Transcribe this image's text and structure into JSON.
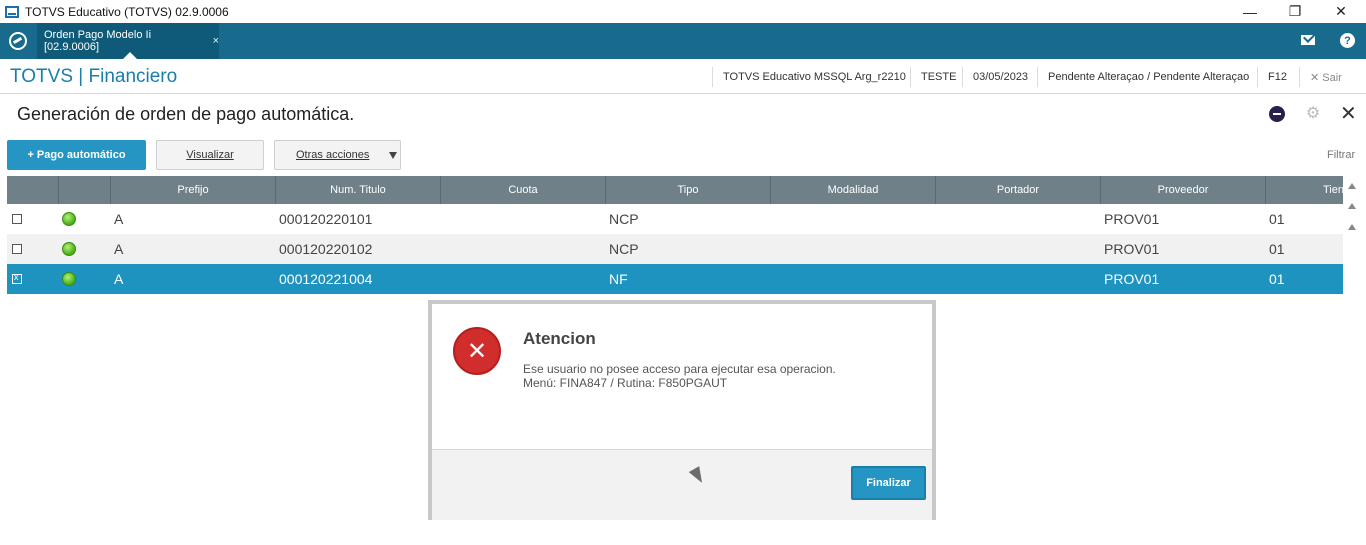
{
  "window": {
    "title": "TOTVS Educativo (TOTVS) 02.9.0006",
    "minimize": "—",
    "restore": "❐",
    "close": "✕"
  },
  "tabs": [
    {
      "label": "Orden Pago Modelo Ii [02.9.0006]",
      "close": "×"
    }
  ],
  "header": {
    "brand": "TOTVS | Financiero",
    "environment": "TOTVS Educativo MSSQL Arg_r2210",
    "user": "TESTE",
    "date": "03/05/2023",
    "status": "Pendente Alteraçao / Pendente Alteraçao",
    "shortcut": "F12",
    "exit": "✕  Sair",
    "help": "?"
  },
  "page": {
    "title": "Generación de orden de pago automática."
  },
  "toolbar": {
    "primary_label": "+ Pago automático",
    "visualizar_label": "Visualizar",
    "otras_label": "Otras acciones",
    "filter_label": "Filtrar"
  },
  "grid": {
    "columns": [
      "",
      "",
      "Prefijo",
      "Num. Titulo",
      "Cuota",
      "Tipo",
      "Modalidad",
      "Portador",
      "Proveedor",
      "Tien"
    ],
    "rows": [
      {
        "checked": false,
        "prefijo": "A",
        "num_titulo": "000120220101",
        "cuota": "",
        "tipo": "NCP",
        "modalidad": "",
        "portador": "",
        "proveedor": "PROV01",
        "tienda": "01"
      },
      {
        "checked": false,
        "prefijo": "A",
        "num_titulo": "000120220102",
        "cuota": "",
        "tipo": "NCP",
        "modalidad": "",
        "portador": "",
        "proveedor": "PROV01",
        "tienda": "01"
      },
      {
        "checked": true,
        "prefijo": "A",
        "num_titulo": "000120221004",
        "cuota": "",
        "tipo": "NF",
        "modalidad": "",
        "portador": "",
        "proveedor": "PROV01",
        "tienda": "01"
      }
    ]
  },
  "dialog": {
    "icon": "✕",
    "title": "Atencion",
    "message_line1": "Ese usuario no posee acceso para ejecutar esa operacion.",
    "message_line2": "Menú: FINA847 / Rutina: F850PGAUT",
    "button": "Finalizar"
  },
  "colors": {
    "brand_blue": "#1a7fa8",
    "tabbar": "#186b8c",
    "selected_row": "#1f93bf",
    "error_red": "#d22d2d"
  }
}
